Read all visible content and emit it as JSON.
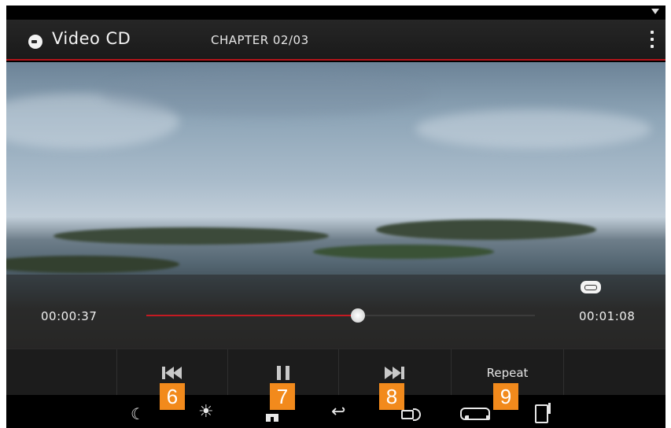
{
  "header": {
    "title": "Video CD",
    "chapter": "CHAPTER 02/03"
  },
  "playback": {
    "current_time": "00:00:37",
    "total_time": "00:01:08",
    "progress": 0.544
  },
  "controls": {
    "repeat_label": "Repeat"
  },
  "callouts": [
    "6",
    "7",
    "8",
    "9"
  ],
  "icons": {
    "disc": "disc-icon",
    "menu": "more-vert-icon",
    "repeat": "repeat-icon",
    "prev": "skip-previous-icon",
    "pause": "pause-icon",
    "next": "skip-next-icon",
    "night": "moon-icon",
    "brightness": "sun-icon",
    "home": "home-icon",
    "back": "back-icon",
    "volume": "volume-icon",
    "car": "car-icon",
    "phone": "phone-icon"
  },
  "colors": {
    "accent": "#c41a22",
    "callout": "#f28a1c"
  }
}
